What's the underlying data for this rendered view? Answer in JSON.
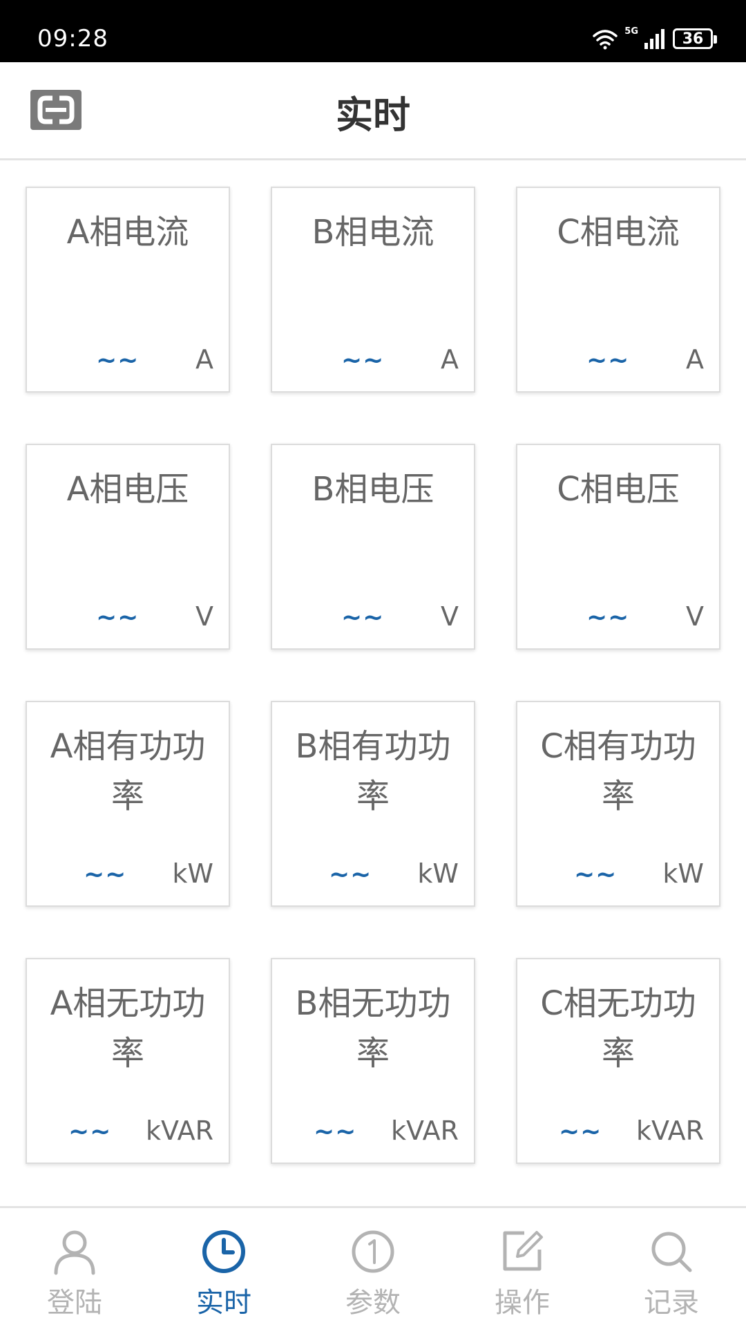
{
  "status_bar": {
    "time": "09:28",
    "network": "5G",
    "battery": "36"
  },
  "header": {
    "title": "实时",
    "logo_icon": "equipment-logo-icon"
  },
  "cards": [
    {
      "title": "A相电流",
      "value": "~~",
      "unit": "A"
    },
    {
      "title": "B相电流",
      "value": "~~",
      "unit": "A"
    },
    {
      "title": "C相电流",
      "value": "~~",
      "unit": "A"
    },
    {
      "title": "A相电压",
      "value": "~~",
      "unit": "V"
    },
    {
      "title": "B相电压",
      "value": "~~",
      "unit": "V"
    },
    {
      "title": "C相电压",
      "value": "~~",
      "unit": "V"
    },
    {
      "title": "A相有功功率",
      "value": "~~",
      "unit": "kW"
    },
    {
      "title": "B相有功功率",
      "value": "~~",
      "unit": "kW"
    },
    {
      "title": "C相有功功率",
      "value": "~~",
      "unit": "kW"
    },
    {
      "title": "A相无功功率",
      "value": "~~",
      "unit": "kVAR"
    },
    {
      "title": "B相无功功率",
      "value": "~~",
      "unit": "kVAR"
    },
    {
      "title": "C相无功功率",
      "value": "~~",
      "unit": "kVAR"
    }
  ],
  "nav": [
    {
      "label": "登陆",
      "icon": "user-icon",
      "active": false
    },
    {
      "label": "实时",
      "icon": "clock-icon",
      "active": true
    },
    {
      "label": "参数",
      "icon": "number-one-circle-icon",
      "active": false
    },
    {
      "label": "操作",
      "icon": "edit-icon",
      "active": false
    },
    {
      "label": "记录",
      "icon": "search-icon",
      "active": false
    }
  ],
  "colors": {
    "accent": "#1a64a8",
    "inactive": "#b3b3b3",
    "text": "#666666"
  }
}
